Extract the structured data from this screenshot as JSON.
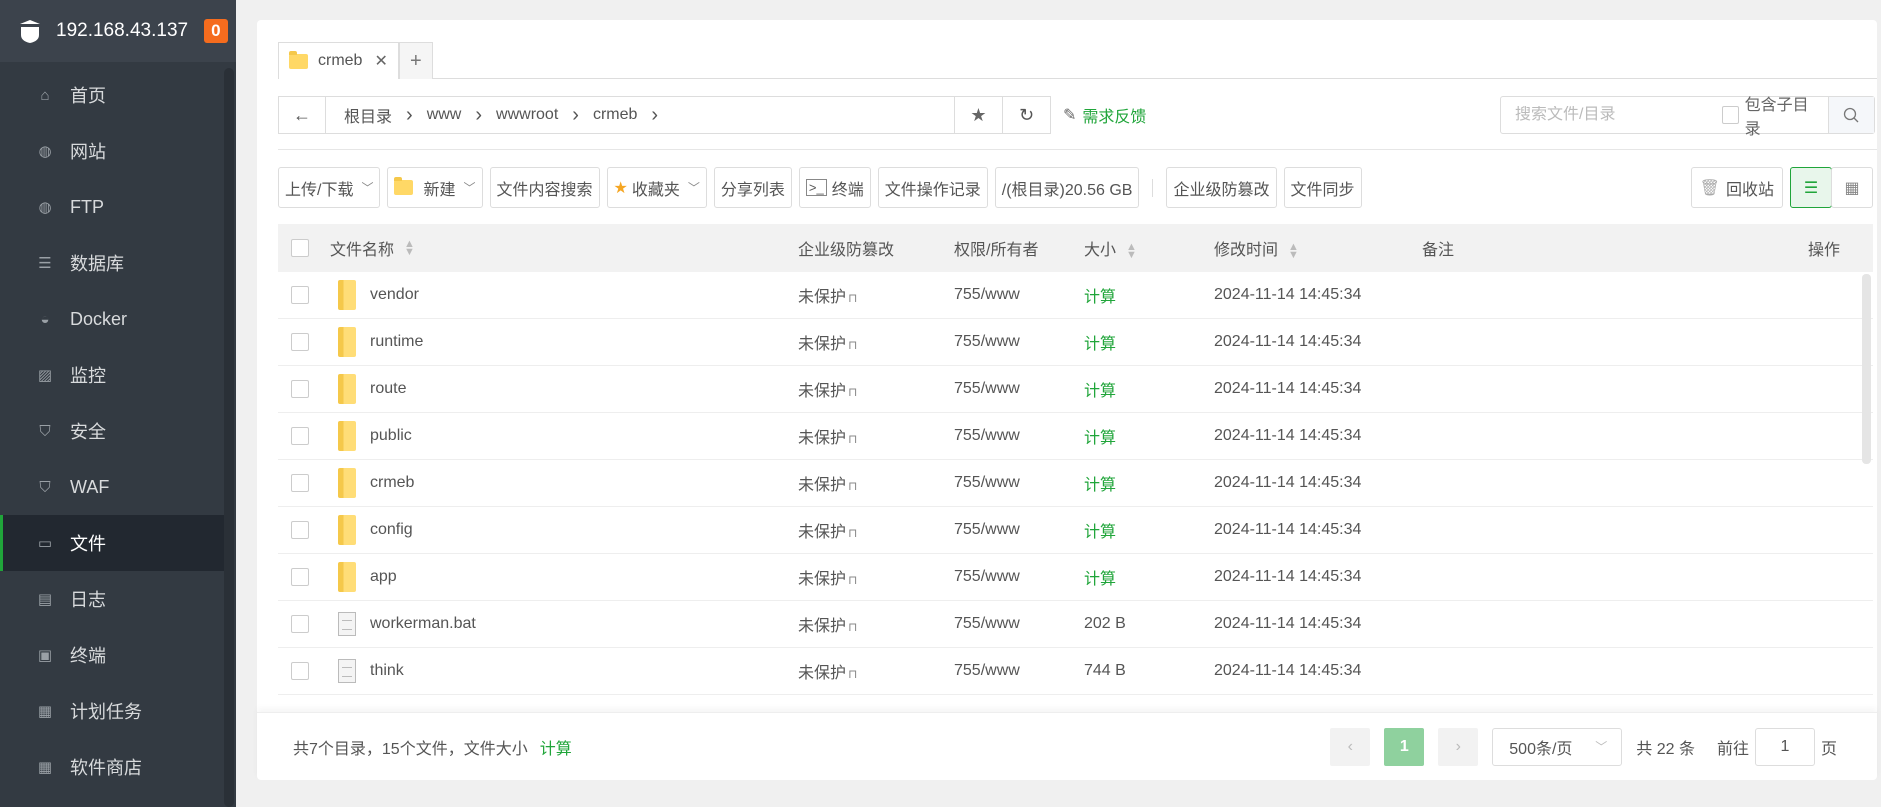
{
  "sidebar": {
    "host": "192.168.43.137",
    "badge": "0",
    "items": [
      {
        "label": "首页",
        "icon": "home-icon",
        "glyph": "⌂"
      },
      {
        "label": "网站",
        "icon": "globe-icon",
        "glyph": "◍"
      },
      {
        "label": "FTP",
        "icon": "ftp-icon",
        "glyph": "◍"
      },
      {
        "label": "数据库",
        "icon": "database-icon",
        "glyph": "☰"
      },
      {
        "label": "Docker",
        "icon": "docker-icon",
        "glyph": "◒"
      },
      {
        "label": "监控",
        "icon": "monitor-icon",
        "glyph": "▨"
      },
      {
        "label": "安全",
        "icon": "shield-icon",
        "glyph": "⛉"
      },
      {
        "label": "WAF",
        "icon": "waf-icon",
        "glyph": "⛉"
      },
      {
        "label": "文件",
        "icon": "folder-icon",
        "glyph": "▭",
        "active": true
      },
      {
        "label": "日志",
        "icon": "log-icon",
        "glyph": "▤"
      },
      {
        "label": "终端",
        "icon": "terminal-icon",
        "glyph": "▣"
      },
      {
        "label": "计划任务",
        "icon": "calendar-icon",
        "glyph": "▦"
      },
      {
        "label": "软件商店",
        "icon": "apps-icon",
        "glyph": "▦"
      }
    ]
  },
  "tabs": {
    "active": "crmeb",
    "add": "+"
  },
  "breadcrumb": {
    "segments": [
      "根目录",
      "www",
      "wwwroot",
      "crmeb"
    ],
    "feedback": "需求反馈"
  },
  "search": {
    "placeholder": "搜索文件/目录",
    "include_sub": "包含子目录"
  },
  "toolbar": {
    "upload": "上传/下载",
    "new": "新建",
    "content_search": "文件内容搜索",
    "favorites": "收藏夹",
    "share_list": "分享列表",
    "terminal": "终端",
    "op_log": "文件操作记录",
    "disk": "/(根目录)20.56 GB",
    "tamper": "企业级防篡改",
    "sync": "文件同步",
    "recycle": "回收站"
  },
  "table": {
    "headers": {
      "name": "文件名称",
      "tamper": "企业级防篡改",
      "perm": "权限/所有者",
      "size": "大小",
      "mtime": "修改时间",
      "note": "备注",
      "ops": "操作"
    },
    "rows": [
      {
        "name": "vendor",
        "type": "folder",
        "tamper": "未保护",
        "perm": "755/www",
        "size": "计算",
        "mtime": "2024-11-14 14:45:34"
      },
      {
        "name": "runtime",
        "type": "folder",
        "tamper": "未保护",
        "perm": "755/www",
        "size": "计算",
        "mtime": "2024-11-14 14:45:34"
      },
      {
        "name": "route",
        "type": "folder",
        "tamper": "未保护",
        "perm": "755/www",
        "size": "计算",
        "mtime": "2024-11-14 14:45:34"
      },
      {
        "name": "public",
        "type": "folder",
        "tamper": "未保护",
        "perm": "755/www",
        "size": "计算",
        "mtime": "2024-11-14 14:45:34"
      },
      {
        "name": "crmeb",
        "type": "folder",
        "tamper": "未保护",
        "perm": "755/www",
        "size": "计算",
        "mtime": "2024-11-14 14:45:34"
      },
      {
        "name": "config",
        "type": "folder",
        "tamper": "未保护",
        "perm": "755/www",
        "size": "计算",
        "mtime": "2024-11-14 14:45:34"
      },
      {
        "name": "app",
        "type": "folder",
        "tamper": "未保护",
        "perm": "755/www",
        "size": "计算",
        "mtime": "2024-11-14 14:45:34"
      },
      {
        "name": "workerman.bat",
        "type": "file",
        "tamper": "未保护",
        "perm": "755/www",
        "size": "202 B",
        "mtime": "2024-11-14 14:45:34"
      },
      {
        "name": "think",
        "type": "file",
        "tamper": "未保护",
        "perm": "755/www",
        "size": "744 B",
        "mtime": "2024-11-14 14:45:34"
      }
    ]
  },
  "footer": {
    "summary": "共7个目录，15个文件，文件大小",
    "calc": "计算",
    "page": "1",
    "page_size": "500条/页",
    "total": "共 22 条",
    "goto": "前往",
    "goto_value": "1",
    "page_unit": "页"
  },
  "colors": {
    "accent": "#20a53a",
    "sidebar": "#333a42",
    "badge": "#f56c1e"
  }
}
